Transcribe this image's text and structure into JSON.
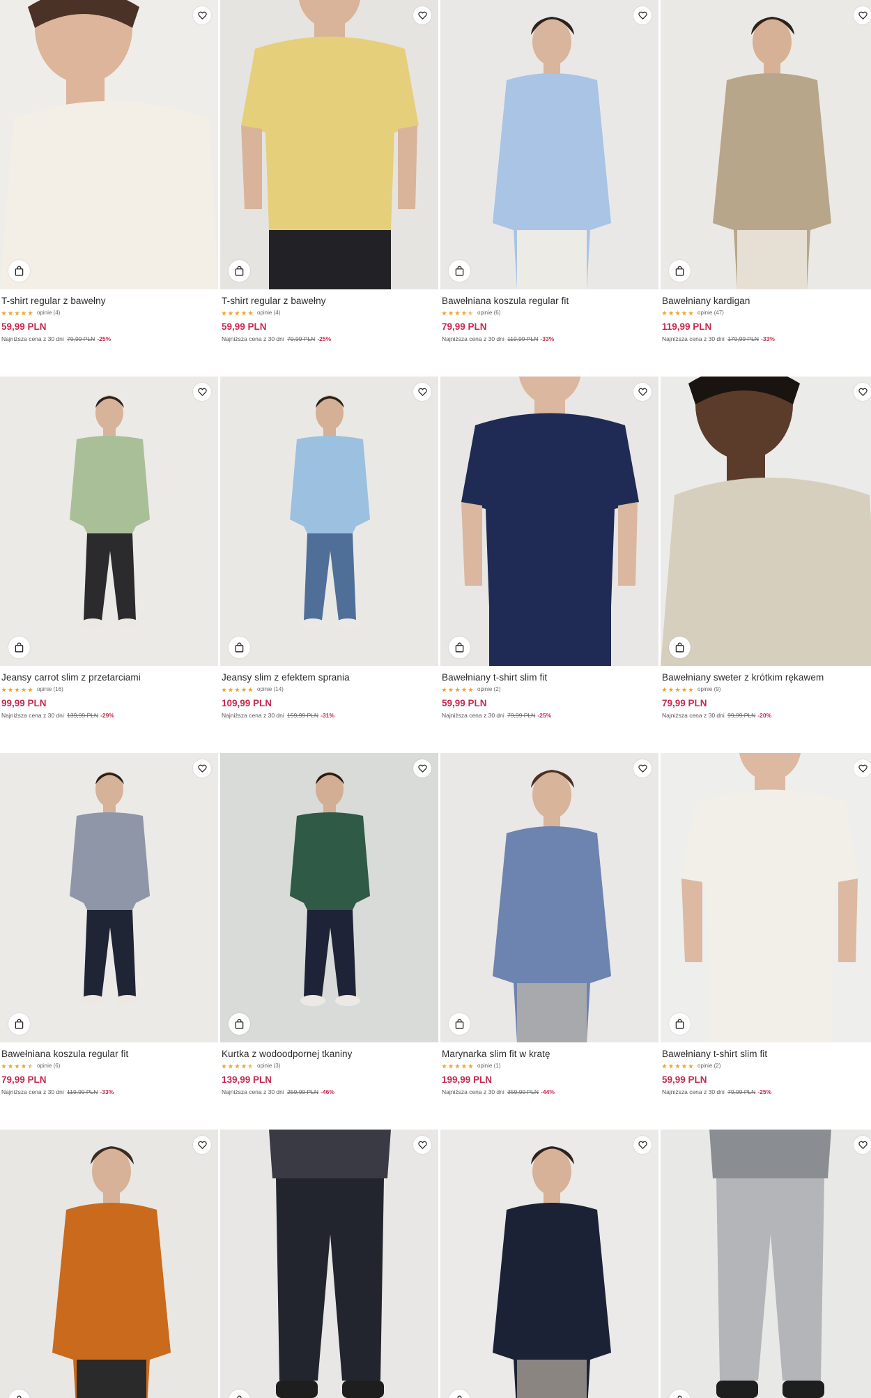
{
  "colors": {
    "price": "#c62a4f",
    "star": "#f0a530",
    "background": "#ffffff"
  },
  "icons": {
    "favorite": "heart-icon",
    "cart": "shopping-bag-icon",
    "rating": "star-icon"
  },
  "products": [
    {
      "name": "T-shirt regular z bawełny",
      "rating": 5,
      "reviews": "opinie (4)",
      "price": "59,99 PLN",
      "lowest_label": "Najniższa cena z 30 dni",
      "old_price": "79,99 PLN",
      "discount": "-25%",
      "photo": {
        "bg": "#eeedea",
        "top": "#f3efe6",
        "bottom": "#f3efe6",
        "skin": "#dcb59a",
        "hair": "#4a3226",
        "view": "close"
      }
    },
    {
      "name": "T-shirt regular z bawełny",
      "rating": 5,
      "reviews": "opinie (4)",
      "price": "59,99 PLN",
      "lowest_label": "Najniższa cena z 30 dni",
      "old_price": "79,99 PLN",
      "discount": "-25%",
      "photo": {
        "bg": "#e6e4e1",
        "top": "#e6cf7a",
        "bottom": "#222226",
        "skin": "#d9b49a",
        "hair": "#3a2a20",
        "view": "torso"
      }
    },
    {
      "name": "Bawełniana koszula regular fit",
      "rating": 4.5,
      "reviews": "opinie (6)",
      "price": "79,99 PLN",
      "lowest_label": "Najniższa cena z 30 dni",
      "old_price": "119,99 PLN",
      "discount": "-33%",
      "photo": {
        "bg": "#e9e8e7",
        "top": "#a9c4e4",
        "bottom": "#ecebe6",
        "skin": "#d8b59c",
        "hair": "#2b211c",
        "view": "half"
      }
    },
    {
      "name": "Bawełniany kardigan",
      "rating": 5,
      "reviews": "opinie (47)",
      "price": "119,99 PLN",
      "lowest_label": "Najniższa cena z 30 dni",
      "old_price": "179,99 PLN",
      "discount": "-33%",
      "photo": {
        "bg": "#ebe9e6",
        "top": "#b7a68a",
        "bottom": "#e6e0d4",
        "skin": "#d6b196",
        "hair": "#2c221c",
        "view": "half"
      }
    },
    {
      "name": "Jeansy carrot slim z przetarciami",
      "rating": 5,
      "reviews": "opinie (16)",
      "price": "99,99 PLN",
      "lowest_label": "Najniższa cena z 30 dni",
      "old_price": "139,99 PLN",
      "discount": "-29%",
      "photo": {
        "bg": "#eceae7",
        "top": "#a9bf98",
        "bottom": "#2b2b2e",
        "skin": "#d7b39a",
        "hair": "#2a221d",
        "view": "full"
      }
    },
    {
      "name": "Jeansy slim z efektem sprania",
      "rating": 5,
      "reviews": "opinie (14)",
      "price": "109,99 PLN",
      "lowest_label": "Najniższa cena z 30 dni",
      "old_price": "159,99 PLN",
      "discount": "-31%",
      "photo": {
        "bg": "#eae8e5",
        "top": "#9cc0df",
        "bottom": "#4f6f99",
        "skin": "#d5b096",
        "hair": "#2a211b",
        "view": "full"
      }
    },
    {
      "name": "Bawełniany t-shirt slim fit",
      "rating": 5,
      "reviews": "opinie (2)",
      "price": "59,99 PLN",
      "lowest_label": "Najniższa cena z 30 dni",
      "old_price": "79,99 PLN",
      "discount": "-25%",
      "photo": {
        "bg": "#e8e7e5",
        "top": "#1f2b55",
        "bottom": "#1f2b55",
        "skin": "#dab79e",
        "hair": "#2f241d",
        "view": "torso"
      }
    },
    {
      "name": "Bawełniany sweter z krótkim rękawem",
      "rating": 5,
      "reviews": "opinie (9)",
      "price": "79,99 PLN",
      "lowest_label": "Najniższa cena z 30 dni",
      "old_price": "99,99 PLN",
      "discount": "-20%",
      "photo": {
        "bg": "#ebebea",
        "top": "#d7cfbe",
        "bottom": "#d7cfbe",
        "skin": "#5b3b2a",
        "hair": "#1a1411",
        "view": "close"
      }
    },
    {
      "name": "Bawełniana koszula regular fit",
      "rating": 4.5,
      "reviews": "opinie (6)",
      "price": "79,99 PLN",
      "lowest_label": "Najniższa cena z 30 dni",
      "old_price": "119,99 PLN",
      "discount": "-33%",
      "photo": {
        "bg": "#eceae7",
        "top": "#8e96a8",
        "bottom": "#1f2535",
        "skin": "#d6b299",
        "hair": "#2a201a",
        "view": "full"
      }
    },
    {
      "name": "Kurtka z wodoodpornej tkaniny",
      "rating": 4.5,
      "reviews": "opinie (3)",
      "price": "139,99 PLN",
      "lowest_label": "Najniższa cena z 30 dni",
      "old_price": "259,99 PLN",
      "discount": "-46%",
      "photo": {
        "bg": "#d9dbd8",
        "top": "#2f5a45",
        "bottom": "#1e2338",
        "skin": "#d4ae94",
        "hair": "#241c17",
        "view": "full"
      }
    },
    {
      "name": "Marynarka slim fit w kratę",
      "rating": 5,
      "reviews": "opinie (1)",
      "price": "199,99 PLN",
      "lowest_label": "Najniższa cena z 30 dni",
      "old_price": "359,99 PLN",
      "discount": "-44%",
      "photo": {
        "bg": "#e9e8e6",
        "top": "#6d83b0",
        "bottom": "#a8a9ac",
        "skin": "#d8b49b",
        "hair": "#4a3022",
        "view": "half"
      }
    },
    {
      "name": "Bawełniany t-shirt slim fit",
      "rating": 5,
      "reviews": "opinie (2)",
      "price": "59,99 PLN",
      "lowest_label": "Najniższa cena z 30 dni",
      "old_price": "79,99 PLN",
      "discount": "-25%",
      "photo": {
        "bg": "#eeeeed",
        "top": "#f2efe8",
        "bottom": "#f2efe8",
        "skin": "#dcb9a0",
        "hair": "#2e231c",
        "view": "torso"
      }
    },
    {
      "name": "",
      "rating": 0,
      "reviews": "",
      "price": "",
      "lowest_label": "",
      "old_price": "",
      "discount": "",
      "photo": {
        "bg": "#e9e7e4",
        "top": "#c96a1c",
        "bottom": "#2a2a2a",
        "skin": "#d7b298",
        "hair": "#3a2a20",
        "view": "half"
      }
    },
    {
      "name": "",
      "rating": 0,
      "reviews": "",
      "price": "",
      "lowest_label": "",
      "old_price": "",
      "discount": "",
      "photo": {
        "bg": "#e8e7e5",
        "top": "#3a3a44",
        "bottom": "#22252d",
        "skin": "#d7b298",
        "hair": "#2a201a",
        "view": "legs"
      }
    },
    {
      "name": "",
      "rating": 0,
      "reviews": "",
      "price": "",
      "lowest_label": "",
      "old_price": "",
      "discount": "",
      "photo": {
        "bg": "#ebeae8",
        "top": "#1c2236",
        "bottom": "#8a8580",
        "skin": "#d7b298",
        "hair": "#2d221b",
        "view": "half"
      }
    },
    {
      "name": "",
      "rating": 0,
      "reviews": "",
      "price": "",
      "lowest_label": "",
      "old_price": "",
      "discount": "",
      "photo": {
        "bg": "#e8e8e7",
        "top": "#8a8d92",
        "bottom": "#b3b5b8",
        "skin": "#d7b298",
        "hair": "#2d221b",
        "view": "legs"
      }
    }
  ]
}
